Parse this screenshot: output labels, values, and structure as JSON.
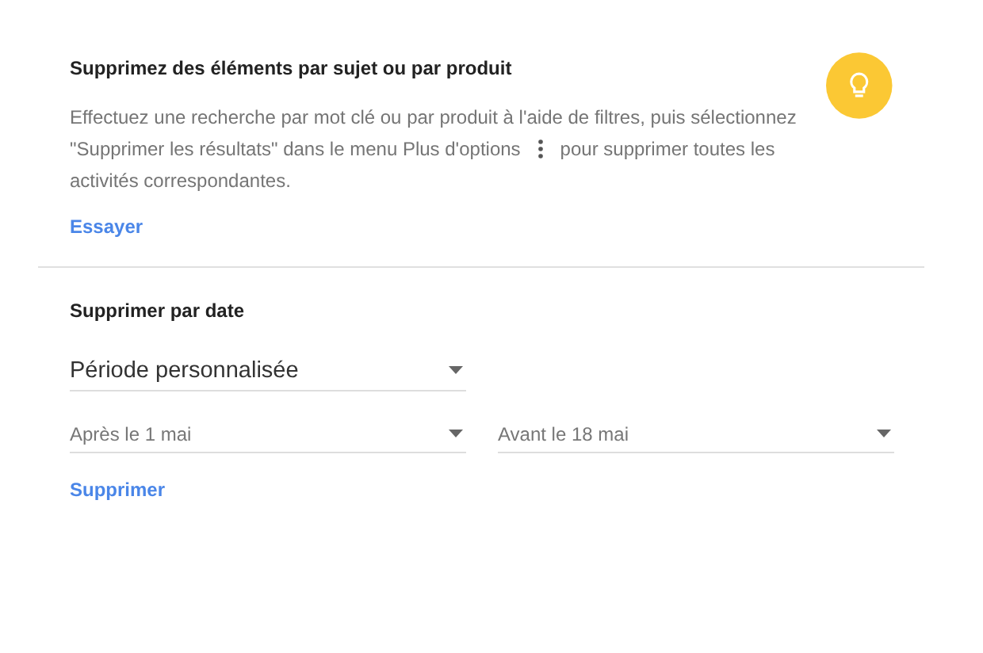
{
  "topic_section": {
    "title": "Supprimez des éléments par sujet ou par produit",
    "description_lines": [
      "Effectuez une recherche par mot clé ou par produit à l'aide de filtres, puis sélectionnez",
      "\"Supprimer les résultats\" dans le menu Plus d'options",
      "pour supprimer toutes les",
      "activités correspondantes."
    ],
    "link": "Essayer"
  },
  "date_section": {
    "title": "Supprimer par date",
    "range_select": "Période personnalisée",
    "start_select": "Après le 1 mai",
    "end_select": "Avant le 18 mai",
    "button": "Supprimer"
  }
}
